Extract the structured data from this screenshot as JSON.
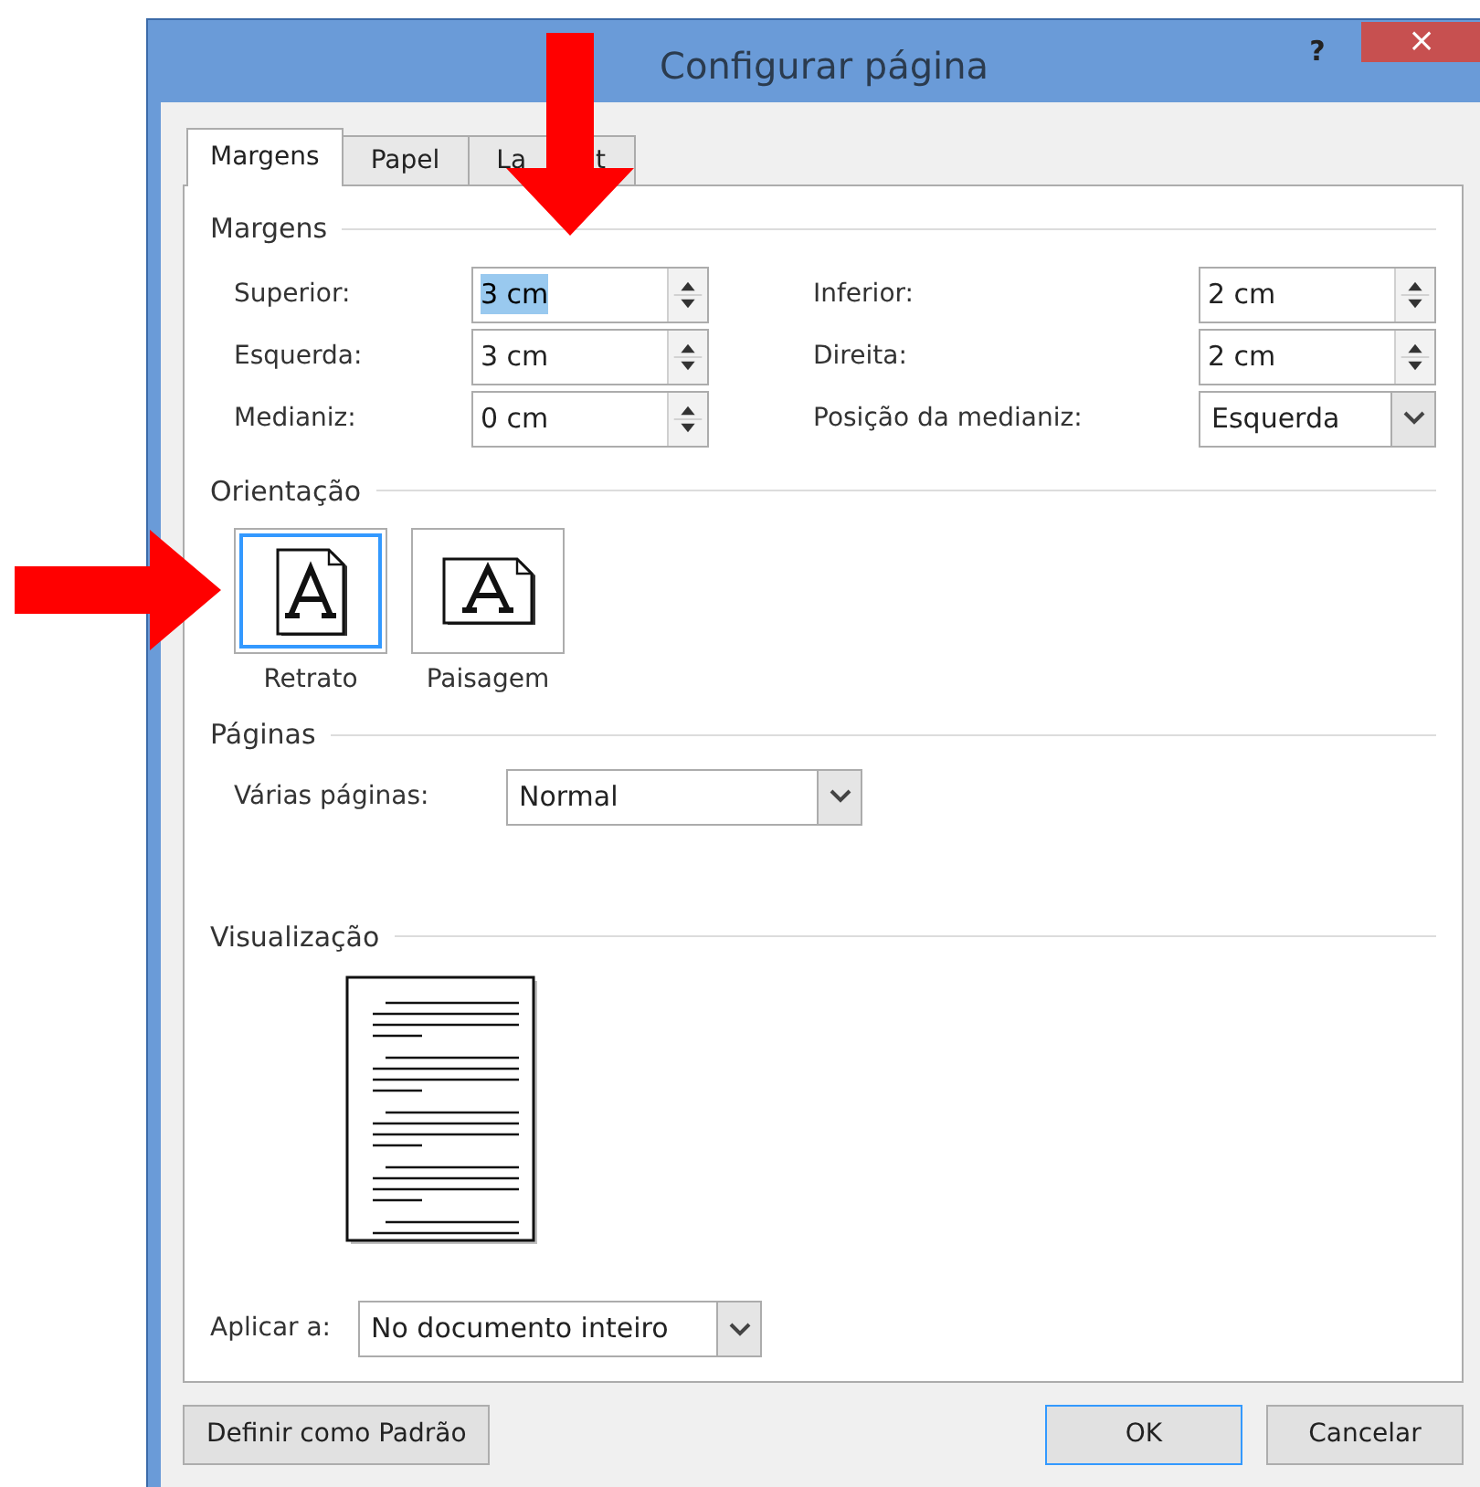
{
  "window": {
    "title": "Configurar página",
    "help": "?",
    "close": "×"
  },
  "tabs": [
    {
      "label": "Margens",
      "selected": true
    },
    {
      "label": "Papel",
      "selected": false
    },
    {
      "label_parts": [
        "La",
        "t"
      ],
      "selected": false
    }
  ],
  "margins": {
    "heading": "Margens",
    "fields": [
      {
        "label": "Superior:",
        "value": "3 cm",
        "kind": "spin",
        "selected": true
      },
      {
        "label": "Inferior:",
        "value": "2 cm",
        "kind": "spin",
        "selected": false
      },
      {
        "label": "Esquerda:",
        "value": "3 cm",
        "kind": "spin",
        "selected": false
      },
      {
        "label": "Direita:",
        "value": "2 cm",
        "kind": "spin",
        "selected": false
      },
      {
        "label": "Medianiz:",
        "value": "0 cm",
        "kind": "spin",
        "selected": false
      },
      {
        "label": "Posição da medianiz:",
        "value": "Esquerda",
        "kind": "dropdown",
        "selected": false
      }
    ]
  },
  "orientation": {
    "heading": "Orientação",
    "options": [
      {
        "label": "Retrato",
        "kind": "portrait",
        "selected": true
      },
      {
        "label": "Paisagem",
        "kind": "landscape",
        "selected": false
      }
    ]
  },
  "pages": {
    "heading": "Páginas",
    "label": "Várias páginas:",
    "value": "Normal"
  },
  "preview": {
    "heading": "Visualização"
  },
  "apply": {
    "label": "Aplicar a:",
    "value": "No documento inteiro"
  },
  "buttons": [
    {
      "label": "Definir como Padrão",
      "default": false
    },
    {
      "label": "OK",
      "default": true
    },
    {
      "label": "Cancelar",
      "default": false
    }
  ]
}
